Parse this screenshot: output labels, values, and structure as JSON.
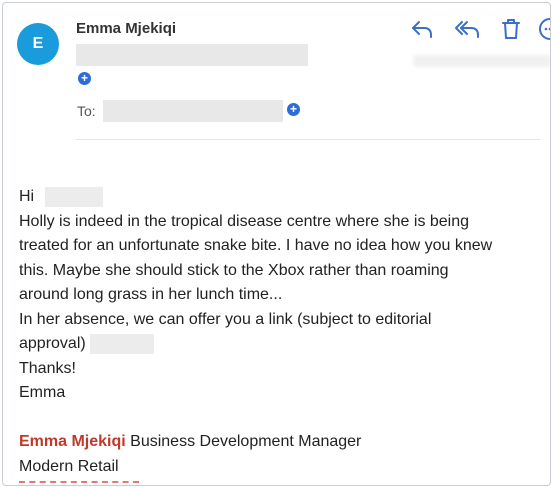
{
  "header": {
    "avatar_initial": "E",
    "sender_name": "Emma Mjekiqi",
    "to_label": "To:"
  },
  "toolbar": {
    "reply_icon": "reply-icon",
    "reply_all_icon": "reply-all-icon",
    "delete_icon": "trash-icon",
    "more_icon": "more-icon"
  },
  "message": {
    "greeting": "Hi",
    "lines": [
      "Holly is indeed in the tropical disease centre where she is being",
      "treated for an unfortunate snake bite. I have no idea how you knew",
      "this. Maybe she should stick to the Xbox rather than roaming",
      "around long grass in her lunch time...",
      "In her absence, we can offer you a link (subject to editorial"
    ],
    "approval_text": "approval)",
    "thanks": "Thanks!",
    "signoff": "Emma"
  },
  "signature": {
    "name": "Emma Mjekiqi",
    "title": " Business Development Manager",
    "company": "Modern Retail"
  },
  "colors": {
    "avatar": "#1a9bdc",
    "accent_blue": "#2f6bd8",
    "signature_red": "#c0392b",
    "icon_blue": "#3b6fc9"
  }
}
